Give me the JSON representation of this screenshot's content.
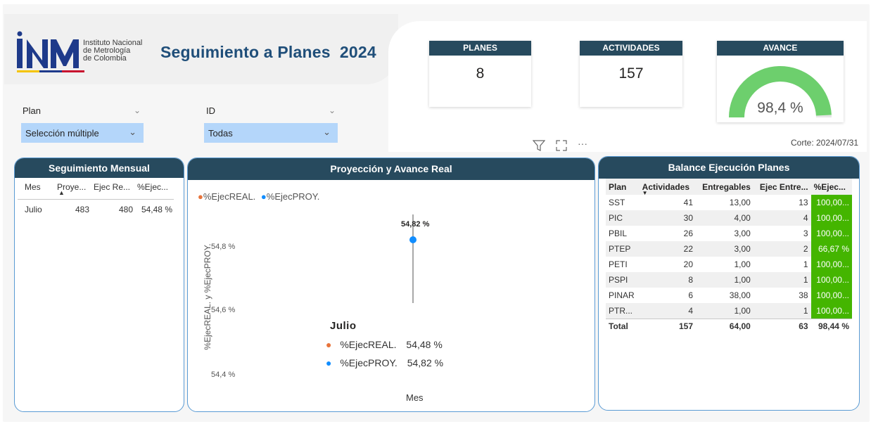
{
  "header": {
    "logo_letters": "INM",
    "org_line1": "Instituto Nacional",
    "org_line2": "de Metrología",
    "org_line3": "de Colombia",
    "title": "Seguimiento a Planes  2024"
  },
  "kpis": {
    "planes_label": "PLANES",
    "planes_value": "8",
    "actividades_label": "ACTIVIDADES",
    "actividades_value": "157",
    "avance_label": "AVANCE",
    "avance_value": "98,4 %",
    "avance_fraction": 0.984
  },
  "slicers": {
    "plan_label": "Plan",
    "plan_value": "Selección múltiple",
    "id_label": "ID",
    "id_value": "Todas"
  },
  "corte": "Corte: 2024/07/31",
  "colors": {
    "header_bg": "#274a5e",
    "gauge_fill": "#6dcf6d",
    "pct_fill": "#44b500",
    "real_color": "#e8743b",
    "proy_color": "#118dff",
    "dropdown_bg": "#b4d6fa"
  },
  "mensual": {
    "title": "Seguimiento Mensual",
    "col_mes": "Mes",
    "col_proy": "Proye...",
    "col_ejec": "Ejec Re...",
    "col_pct": "%Ejec...",
    "row": {
      "mes": "Julio",
      "proy": "483",
      "ejec": "480",
      "pct": "54,48 %"
    }
  },
  "proyeccion": {
    "title": "Proyección y Avance Real",
    "legend_real": "%EjecREAL.",
    "legend_proy": "%EjecPROY.",
    "ylabel": "%EjecREAL. y %EjecPROY.",
    "xlabel": "Mes",
    "y_ticks": [
      "54,8 %",
      "54,6 %",
      "54,4 %"
    ],
    "point_label": "54,82 %",
    "tooltip_title": "Julio",
    "tooltip_real_label": "%EjecREAL.",
    "tooltip_real_value": "54,48 %",
    "tooltip_proy_label": "%EjecPROY.",
    "tooltip_proy_value": "54,82 %"
  },
  "chart_data": {
    "type": "line",
    "title": "Proyección y Avance Real",
    "xlabel": "Mes",
    "ylabel": "%EjecREAL. y %EjecPROY.",
    "categories": [
      "Julio"
    ],
    "series": [
      {
        "name": "%EjecREAL.",
        "values": [
          54.48
        ]
      },
      {
        "name": "%EjecPROY.",
        "values": [
          54.82
        ]
      }
    ],
    "y_ticks": [
      54.4,
      54.6,
      54.8
    ],
    "legend": "top-left"
  },
  "balance": {
    "title": "Balance Ejecución Planes",
    "columns": [
      "Plan",
      "Actividades",
      "Entregables",
      "Ejec Entre...",
      "%Ejec..."
    ],
    "rows": [
      [
        "SST",
        "41",
        "13,00",
        "13",
        "100,00..."
      ],
      [
        "PIC",
        "30",
        "4,00",
        "4",
        "100,00..."
      ],
      [
        "PBIL",
        "26",
        "3,00",
        "3",
        "100,00..."
      ],
      [
        "PTEP",
        "22",
        "3,00",
        "2",
        "66,67 %"
      ],
      [
        "PETI",
        "20",
        "1,00",
        "1",
        "100,00..."
      ],
      [
        "PSPI",
        "8",
        "1,00",
        "1",
        "100,00..."
      ],
      [
        "PINAR",
        "6",
        "38,00",
        "38",
        "100,00..."
      ],
      [
        "PTR...",
        "4",
        "1,00",
        "1",
        "100,00..."
      ]
    ],
    "total": [
      "Total",
      "157",
      "64,00",
      "63",
      "98,44 %"
    ]
  }
}
